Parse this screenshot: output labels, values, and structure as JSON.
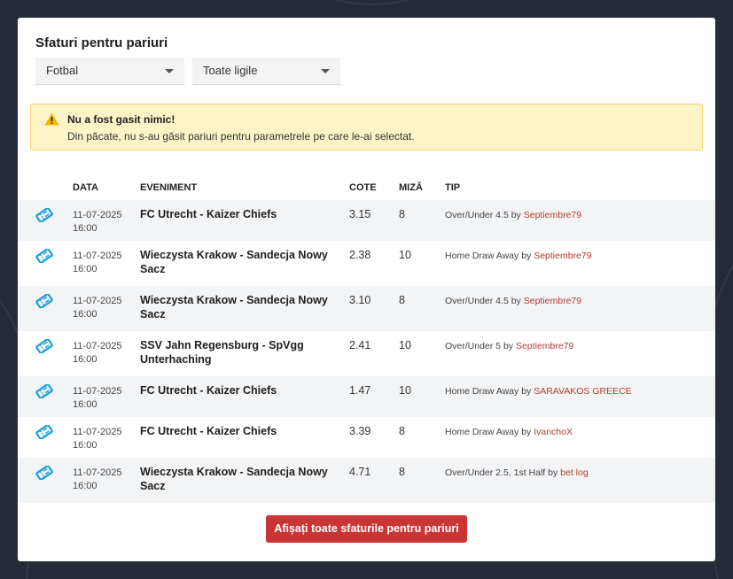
{
  "header": {
    "title": "Sfaturi pentru pariuri"
  },
  "filters": {
    "sport": {
      "selected": "Fotbal"
    },
    "league": {
      "selected": "Toate ligile"
    }
  },
  "alert": {
    "title": "Nu a fost gasit nimic!",
    "message": "Din păcate, nu s-au găsit pariuri pentru parametrele pe care le-ai selectat."
  },
  "table": {
    "columns": {
      "date": "DATA",
      "event": "EVENIMENT",
      "odds": "COTE",
      "stake": "MIZĂ",
      "tip": "TIP"
    },
    "rows": [
      {
        "date": "11-07-2025",
        "time": "16:00",
        "event": "FC Utrecht - Kaizer Chiefs",
        "odds": "3.15",
        "stake": "8",
        "tip": "Over/Under 4.5",
        "by": "by",
        "author": "Septiembre79"
      },
      {
        "date": "11-07-2025",
        "time": "16:00",
        "event": "Wieczysta Krakow - Sandecja Nowy Sacz",
        "odds": "2.38",
        "stake": "10",
        "tip": "Home Draw Away",
        "by": "by",
        "author": "Septiembre79"
      },
      {
        "date": "11-07-2025",
        "time": "16:00",
        "event": "Wieczysta Krakow - Sandecja Nowy Sacz",
        "odds": "3.10",
        "stake": "8",
        "tip": "Over/Under 4.5",
        "by": "by",
        "author": "Septiembre79"
      },
      {
        "date": "11-07-2025",
        "time": "16:00",
        "event": "SSV Jahn Regensburg - SpVgg Unterhaching",
        "odds": "2.41",
        "stake": "10",
        "tip": "Over/Under 5",
        "by": "by",
        "author": "Septiembre79"
      },
      {
        "date": "11-07-2025",
        "time": "16:00",
        "event": "FC Utrecht - Kaizer Chiefs",
        "odds": "1.47",
        "stake": "10",
        "tip": "Home Draw Away",
        "by": "by",
        "author": "SARAVAKOS GREECE"
      },
      {
        "date": "11-07-2025",
        "time": "16:00",
        "event": "FC Utrecht - Kaizer Chiefs",
        "odds": "3.39",
        "stake": "8",
        "tip": "Home Draw Away",
        "by": "by",
        "author": "IvanchoX"
      },
      {
        "date": "11-07-2025",
        "time": "16:00",
        "event": "Wieczysta Krakow - Sandecja Nowy Sacz",
        "odds": "4.71",
        "stake": "8",
        "tip": "Over/Under 2.5, 1st Half",
        "by": "by",
        "author": "bet log"
      }
    ]
  },
  "footer": {
    "show_all_label": "Afișați toate sfaturile pentru pariuri"
  },
  "colors": {
    "accent": "#c93535",
    "link": "#b53a30",
    "ticket_icon": "#1a9fd6",
    "alert_bg": "#fdf3c7",
    "alert_icon": "#f0b400"
  }
}
